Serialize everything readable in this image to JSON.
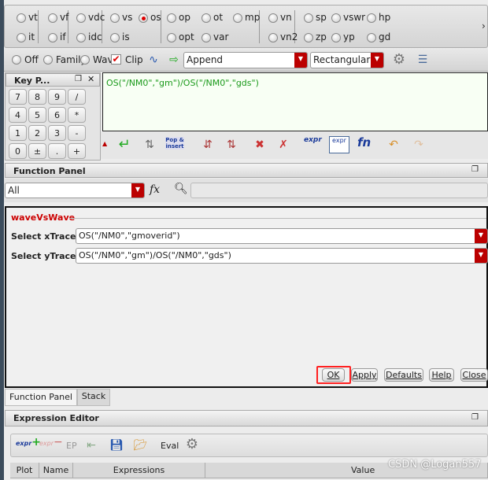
{
  "radios": {
    "row1": [
      {
        "label": "vt",
        "checked": false
      },
      {
        "label": "vf",
        "checked": false
      },
      {
        "label": "vdc",
        "checked": false
      },
      {
        "label": "vs",
        "checked": false
      },
      {
        "label": "os",
        "checked": true
      },
      {
        "label": "op",
        "checked": false
      },
      {
        "label": "ot",
        "checked": false
      },
      {
        "label": "mp",
        "checked": false
      },
      {
        "label": "vn",
        "checked": false
      },
      {
        "label": "sp",
        "checked": false
      },
      {
        "label": "vswr",
        "checked": false
      },
      {
        "label": "hp",
        "checked": false
      }
    ],
    "row2": [
      {
        "label": "it"
      },
      {
        "label": "if"
      },
      {
        "label": "idc"
      },
      {
        "label": "is"
      },
      {
        "label": "opt"
      },
      {
        "label": "var"
      },
      {
        "label": "vn2"
      },
      {
        "label": "zp"
      },
      {
        "label": "yp"
      },
      {
        "label": "gd"
      }
    ]
  },
  "toolbar2": {
    "off": "Off",
    "family": "Family",
    "wave": "Wave",
    "clip": "Clip",
    "clip_checked": true,
    "mode": "Append",
    "format": "Rectangular"
  },
  "keypad": {
    "title": "Key P...",
    "keys": [
      "7",
      "8",
      "9",
      "/",
      "4",
      "5",
      "6",
      "*",
      "1",
      "2",
      "3",
      "-",
      "0",
      "±",
      ".",
      "+"
    ]
  },
  "expression": {
    "text": "OS(\"/NM0\",\"gm\")/OS(\"/NM0\",\"gds\")"
  },
  "buffer_toolbar": {
    "pop_insert": "Pop & insert",
    "expr": "expr",
    "fn": "fn"
  },
  "function_panel": {
    "title": "Function Panel",
    "filter": "All",
    "search_value": "",
    "function_name": "waveVsWave",
    "fields": [
      {
        "label": "Select xTrace",
        "value": "OS(\"/NM0\",\"gmoverid\")"
      },
      {
        "label": "Select yTrace",
        "value": "OS(\"/NM0\",\"gm\")/OS(\"/NM0\",\"gds\")"
      }
    ],
    "buttons": {
      "ok": "OK",
      "apply": "Apply",
      "defaults": "Defaults",
      "help": "Help",
      "close": "Close"
    }
  },
  "tabs": [
    {
      "label": "Function Panel",
      "active": true
    },
    {
      "label": "Stack",
      "active": false
    }
  ],
  "expression_editor": {
    "title": "Expression Editor",
    "ep": "EP",
    "eval": "Eval",
    "columns": [
      "Plot",
      "Name",
      "Expressions",
      "Value"
    ]
  },
  "watermark": "CSDN @Logan557",
  "colors": {
    "accent_red": "#cc0000",
    "expr_green": "#1a9a1a",
    "highlight": "#ff2020"
  }
}
